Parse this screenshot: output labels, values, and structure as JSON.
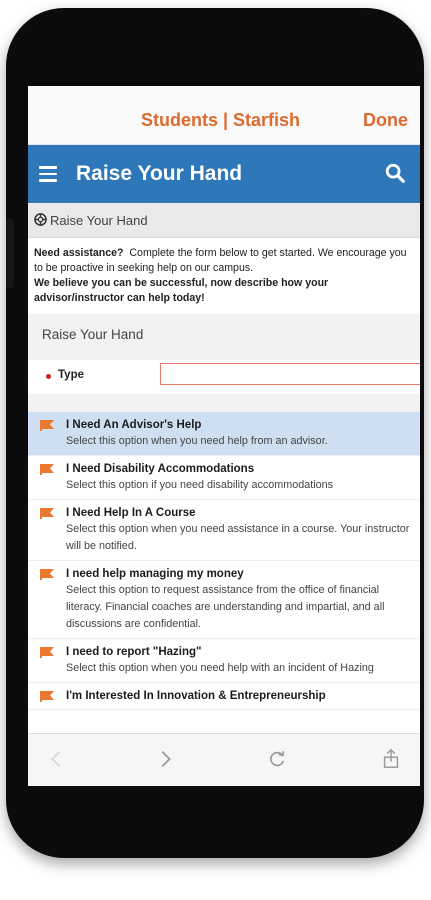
{
  "nav": {
    "title": "Students | Starfish",
    "done_label": "Done"
  },
  "header": {
    "title": "Raise Your Hand",
    "menu_icon": "hamburger-icon",
    "search_icon": "search-icon"
  },
  "section": {
    "title": "Raise Your Hand",
    "icon": "lifebuoy-icon"
  },
  "intro": {
    "line_bold_lead": "Need assistance?",
    "line_rest": "Complete the form below to get started. We encourage you to be proactive in seeking help on our campus.",
    "line_bold": "We believe you can be successful, now describe how your advisor/instructor can help today!"
  },
  "form": {
    "panel_title": "Raise Your Hand",
    "type_label": "Type",
    "type_value": ""
  },
  "options": [
    {
      "title": "I Need An Advisor's Help",
      "desc": "Select this option when you need help from an advisor.",
      "selected": true
    },
    {
      "title": "I Need Disability Accommodations",
      "desc": "Select this option if you need disability accommodations",
      "selected": false
    },
    {
      "title": "I Need Help In A Course",
      "desc": "Select this option when you need assistance in a course. Your instructor will be notified.",
      "selected": false
    },
    {
      "title": "I need help managing my money",
      "desc": "Select this option to request assistance from the office of financial literacy. Financial coaches are understanding and impartial, and all discussions are confidential.",
      "selected": false
    },
    {
      "title": "I need to report \"Hazing\"",
      "desc": "Select this option when you need help with an incident of Hazing",
      "selected": false
    },
    {
      "title": "I'm Interested In Innovation & Entrepreneurship",
      "desc": "",
      "selected": false
    }
  ],
  "colors": {
    "accent_orange": "#dd6a2f",
    "header_blue": "#2e78ba",
    "selected_row": "#cddff0",
    "flag_orange": "#e8792e"
  },
  "bottom_bar": {
    "icons": [
      "back-arrow-icon",
      "forward-arrow-icon",
      "reload-icon",
      "share-icon"
    ]
  }
}
